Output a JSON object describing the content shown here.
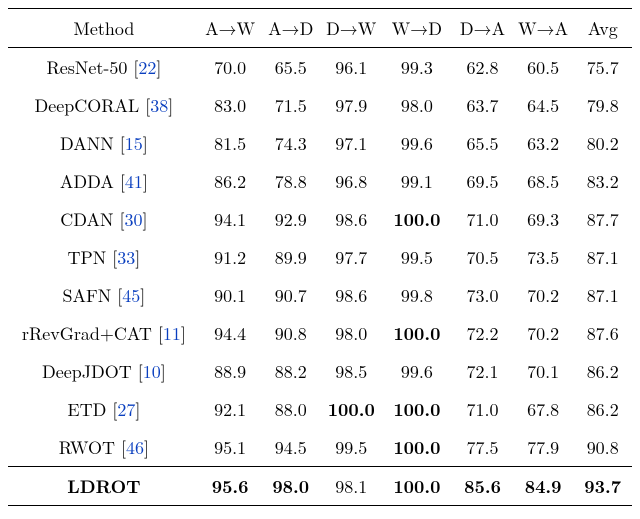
{
  "headers": {
    "method": "Method",
    "cols": [
      "A→W",
      "A→D",
      "D→W",
      "W→D",
      "D→A",
      "W→A",
      "Avg"
    ]
  },
  "rows": [
    {
      "name": "ResNet-50",
      "cite": "22",
      "vals": [
        {
          "v": "70.0"
        },
        {
          "v": "65.5"
        },
        {
          "v": "96.1"
        },
        {
          "v": "99.3"
        },
        {
          "v": "62.8"
        },
        {
          "v": "60.5"
        },
        {
          "v": "75.7"
        }
      ]
    },
    {
      "name": "DeepCORAL",
      "cite": "38",
      "vals": [
        {
          "v": "83.0"
        },
        {
          "v": "71.5"
        },
        {
          "v": "97.9"
        },
        {
          "v": "98.0"
        },
        {
          "v": "63.7"
        },
        {
          "v": "64.5"
        },
        {
          "v": "79.8"
        }
      ]
    },
    {
      "name": "DANN",
      "cite": "15",
      "vals": [
        {
          "v": "81.5"
        },
        {
          "v": "74.3"
        },
        {
          "v": "97.1"
        },
        {
          "v": "99.6"
        },
        {
          "v": "65.5"
        },
        {
          "v": "63.2"
        },
        {
          "v": "80.2"
        }
      ]
    },
    {
      "name": "ADDA",
      "cite": "41",
      "vals": [
        {
          "v": "86.2"
        },
        {
          "v": "78.8"
        },
        {
          "v": "96.8"
        },
        {
          "v": "99.1"
        },
        {
          "v": "69.5"
        },
        {
          "v": "68.5"
        },
        {
          "v": "83.2"
        }
      ]
    },
    {
      "name": "CDAN",
      "cite": "30",
      "vals": [
        {
          "v": "94.1"
        },
        {
          "v": "92.9"
        },
        {
          "v": "98.6"
        },
        {
          "v": "100.0",
          "b": true
        },
        {
          "v": "71.0"
        },
        {
          "v": "69.3"
        },
        {
          "v": "87.7"
        }
      ]
    },
    {
      "name": "TPN",
      "cite": "33",
      "vals": [
        {
          "v": "91.2"
        },
        {
          "v": "89.9"
        },
        {
          "v": "97.7"
        },
        {
          "v": "99.5"
        },
        {
          "v": "70.5"
        },
        {
          "v": "73.5"
        },
        {
          "v": "87.1"
        }
      ]
    },
    {
      "name": "SAFN",
      "cite": "45",
      "vals": [
        {
          "v": "90.1"
        },
        {
          "v": "90.7"
        },
        {
          "v": "98.6"
        },
        {
          "v": "99.8"
        },
        {
          "v": "73.0"
        },
        {
          "v": "70.2"
        },
        {
          "v": "87.1"
        }
      ]
    },
    {
      "name": "rRevGrad+CAT",
      "cite": "11",
      "vals": [
        {
          "v": "94.4"
        },
        {
          "v": "90.8"
        },
        {
          "v": "98.0"
        },
        {
          "v": "100.0",
          "b": true
        },
        {
          "v": "72.2"
        },
        {
          "v": "70.2"
        },
        {
          "v": "87.6"
        }
      ]
    },
    {
      "name": "DeepJDOT",
      "cite": "10",
      "vals": [
        {
          "v": "88.9"
        },
        {
          "v": "88.2"
        },
        {
          "v": "98.5"
        },
        {
          "v": "99.6"
        },
        {
          "v": "72.1"
        },
        {
          "v": "70.1"
        },
        {
          "v": "86.2"
        }
      ]
    },
    {
      "name": "ETD",
      "cite": "27",
      "vals": [
        {
          "v": "92.1"
        },
        {
          "v": "88.0"
        },
        {
          "v": "100.0",
          "b": true
        },
        {
          "v": "100.0",
          "b": true
        },
        {
          "v": "71.0"
        },
        {
          "v": "67.8"
        },
        {
          "v": "86.2"
        }
      ]
    },
    {
      "name": "RWOT",
      "cite": "46",
      "vals": [
        {
          "v": "95.1"
        },
        {
          "v": "94.5"
        },
        {
          "v": "99.5"
        },
        {
          "v": "100.0",
          "b": true
        },
        {
          "v": "77.5"
        },
        {
          "v": "77.9"
        },
        {
          "v": "90.8"
        }
      ]
    }
  ],
  "final": {
    "name": "LDROT",
    "vals": [
      {
        "v": "95.6",
        "b": true
      },
      {
        "v": "98.0",
        "b": true
      },
      {
        "v": "98.1"
      },
      {
        "v": "100.0",
        "b": true
      },
      {
        "v": "85.6",
        "b": true
      },
      {
        "v": "84.9",
        "b": true
      },
      {
        "v": "93.7",
        "b": true
      }
    ]
  }
}
